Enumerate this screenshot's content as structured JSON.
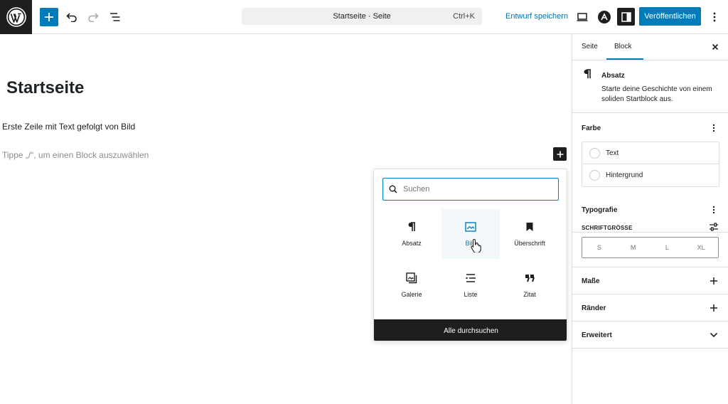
{
  "toolbar": {
    "document_title": "Startseite · Seite",
    "shortcut": "Ctrl+K",
    "save_draft": "Entwurf speichern",
    "publish": "Veröffentlichen"
  },
  "canvas": {
    "page_title": "Startseite",
    "paragraph": "Erste Zeile mit Text gefolgt von Bild",
    "placeholder": "Tippe „/“, um einen Block auszuwählen"
  },
  "inserter": {
    "search_placeholder": "Suchen",
    "blocks": [
      {
        "label": "Absatz",
        "icon": "paragraph-icon"
      },
      {
        "label": "Bild",
        "icon": "image-icon"
      },
      {
        "label": "Überschrift",
        "icon": "heading-icon"
      },
      {
        "label": "Galerie",
        "icon": "gallery-icon"
      },
      {
        "label": "Liste",
        "icon": "list-icon"
      },
      {
        "label": "Zitat",
        "icon": "quote-icon"
      }
    ],
    "browse_all": "Alle durchsuchen"
  },
  "sidebar": {
    "tabs": [
      "Seite",
      "Block"
    ],
    "active_tab": "Block",
    "block_name": "Absatz",
    "block_description": "Starte deine Geschichte von einem soliden Startblock aus.",
    "color": {
      "title": "Farbe",
      "items": [
        "Text",
        "Hintergrund"
      ]
    },
    "typography": {
      "title": "Typografie",
      "font_size_label": "SCHRIFTGRÖSSE",
      "sizes": [
        "S",
        "M",
        "L",
        "XL"
      ]
    },
    "dimensions": "Maße",
    "border": "Ränder",
    "advanced": "Erweitert"
  },
  "colors": {
    "accent": "#007cba",
    "dark": "#1e1e1e"
  }
}
